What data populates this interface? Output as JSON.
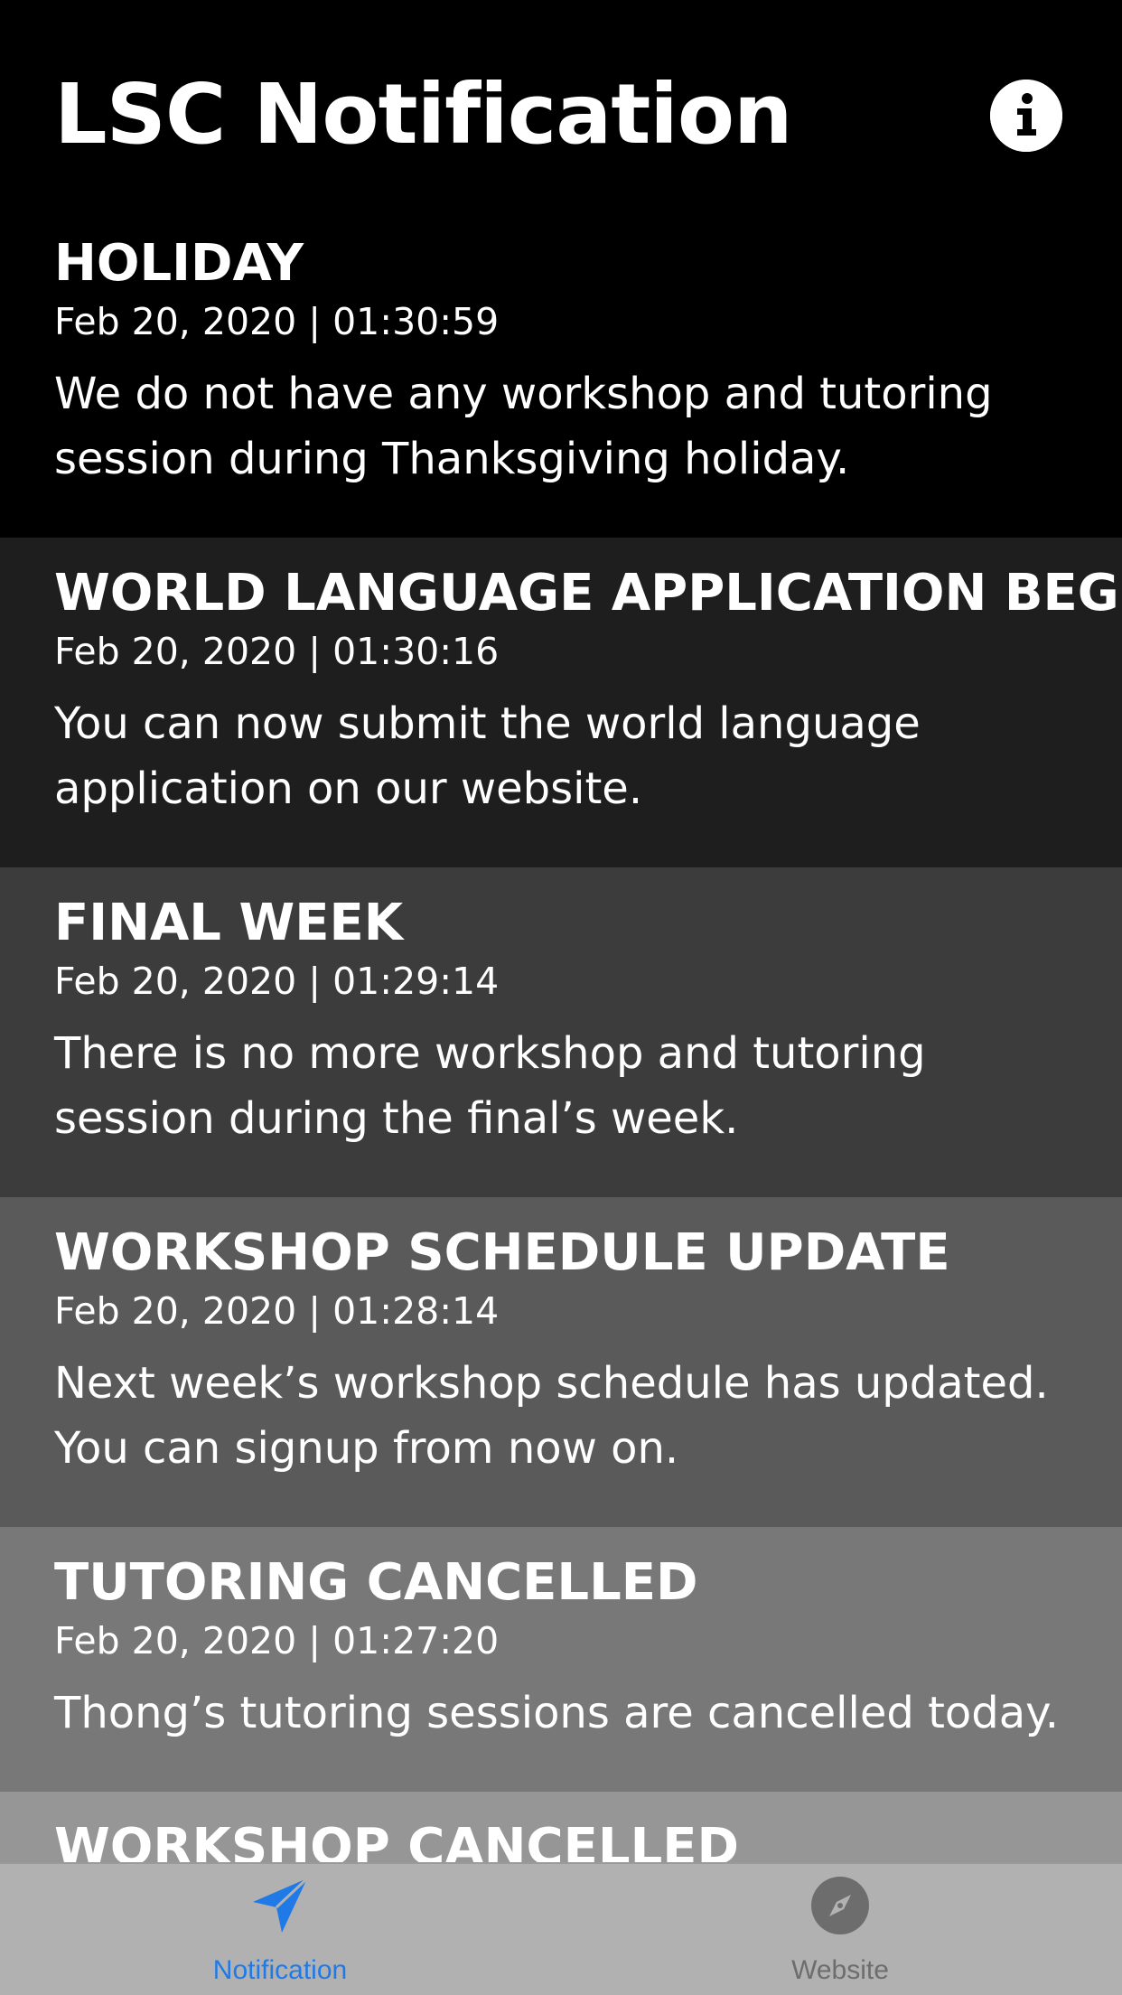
{
  "app": {
    "title": "LSC Notification"
  },
  "notifications": [
    {
      "title": "HOLIDAY",
      "time": "Feb 20, 2020 | 01:30:59",
      "body": "We do not have any workshop and tutoring session during Thanksgiving holiday.",
      "bg": "#000000"
    },
    {
      "title": "WORLD LANGUAGE APPLICATION BEGIN",
      "time": "Feb 20, 2020 | 01:30:16",
      "body": "You can now submit the world language application on our website.",
      "bg": "#1e1e1e"
    },
    {
      "title": "FINAL WEEK",
      "time": "Feb 20, 2020 | 01:29:14",
      "body": "There is no more workshop and tutoring session during the final’s week.",
      "bg": "#3c3c3c"
    },
    {
      "title": "WORKSHOP SCHEDULE UPDATE",
      "time": "Feb 20, 2020 | 01:28:14",
      "body": "Next week’s workshop schedule has updated. You can signup from now on.",
      "bg": "#5a5a5a"
    },
    {
      "title": "TUTORING CANCELLED",
      "time": "Feb 20, 2020 | 01:27:20",
      "body": "Thong’s tutoring sessions are cancelled today.",
      "bg": "#787878"
    },
    {
      "title": "WORKSHOP CANCELLED",
      "time": "",
      "body": "",
      "bg": "#969696"
    }
  ],
  "tabbar": {
    "tabs": [
      {
        "label": "Notification",
        "icon": "paper-plane-icon",
        "selected": true,
        "color": "#1f7ae8"
      },
      {
        "label": "Website",
        "icon": "compass-icon",
        "selected": false,
        "color": "#6d6d6d"
      }
    ]
  }
}
